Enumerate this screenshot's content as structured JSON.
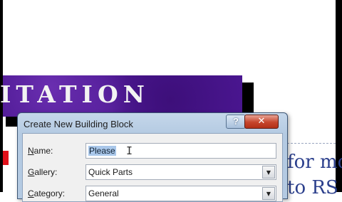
{
  "document": {
    "banner_text": "ITATION",
    "text_line1": "for mo",
    "text_line2": "to RS"
  },
  "dialog": {
    "title": "Create New Building Block",
    "help_label": "?",
    "close_label": "✕",
    "name": {
      "label_key": "N",
      "label_rest": "ame:",
      "value": "Please"
    },
    "gallery": {
      "label_key": "G",
      "label_rest": "allery:",
      "value": "Quick Parts"
    },
    "category": {
      "label_key": "C",
      "label_rest": "ategory:",
      "value": "General"
    }
  },
  "icons": {
    "dropdown": "chevron-down-icon",
    "cursor": "text-cursor-icon"
  },
  "colors": {
    "banner": "#4a1690",
    "close_button": "#c6452c",
    "doc_text": "#2b3f8c"
  }
}
